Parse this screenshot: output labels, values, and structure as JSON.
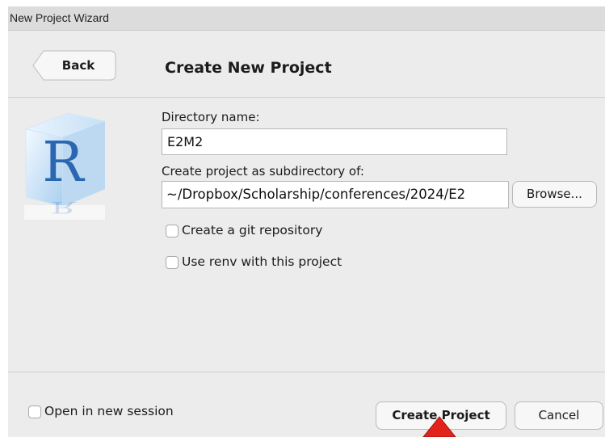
{
  "window": {
    "title": "New Project Wizard"
  },
  "header": {
    "back_label": "Back",
    "title": "Create New Project"
  },
  "logo": {
    "letter": "R"
  },
  "form": {
    "directory_label": "Directory name:",
    "directory_value": "E2M2",
    "parent_label": "Create project as subdirectory of:",
    "parent_value": "~/Dropbox/Scholarship/conferences/2024/E2",
    "browse_label": "Browse...",
    "git_label": "Create a git repository",
    "git_checked": false,
    "renv_label": "Use renv with this project",
    "renv_checked": false
  },
  "footer": {
    "new_session_label": "Open in new session",
    "new_session_checked": false,
    "create_label": "Create Project",
    "cancel_label": "Cancel"
  },
  "colors": {
    "background": "#ececec",
    "cursor": "#e3231b",
    "logo_blue": "#2a67b0"
  }
}
